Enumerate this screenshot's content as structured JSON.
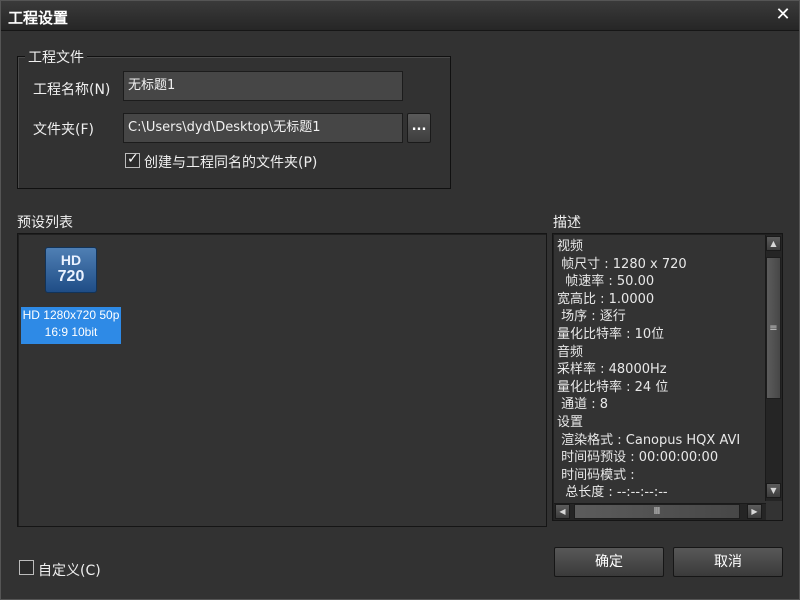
{
  "window": {
    "title": "工程设置"
  },
  "project_file": {
    "group_label": "工程文件",
    "name_label": "工程名称(N)",
    "name_value": "无标题1",
    "folder_label": "文件夹(F)",
    "folder_value": "C:\\Users\\dyd\\Desktop\\无标题1",
    "browse_label": "...",
    "create_folder_label": "创建与工程同名的文件夹(P)",
    "create_folder_checked": true
  },
  "presets": {
    "label": "预设列表",
    "icon_top": "HD",
    "icon_bottom": "720",
    "selected_line1": "HD 1280x720 50p",
    "selected_line2": "16:9 10bit"
  },
  "description": {
    "label": "描述",
    "lines": [
      "视频",
      " 帧尺寸 : 1280 x 720",
      "  帧速率 : 50.00",
      "宽高比 : 1.0000",
      " 场序 : 逐行",
      "量化比特率 : 10位",
      "音频",
      "采样率 : 48000Hz",
      "量化比特率 : 24 位",
      " 通道 : 8",
      "设置",
      " 渲染格式 : Canopus HQX AVI",
      " 时间码预设 : 00:00:00:00",
      " 时间码模式 :",
      "  总长度 : --:--:--:--"
    ]
  },
  "custom": {
    "label": "自定义(C)",
    "checked": false
  },
  "buttons": {
    "ok": "确定",
    "cancel": "取消"
  },
  "icons": {
    "close": "close-icon",
    "check": "check-icon"
  }
}
